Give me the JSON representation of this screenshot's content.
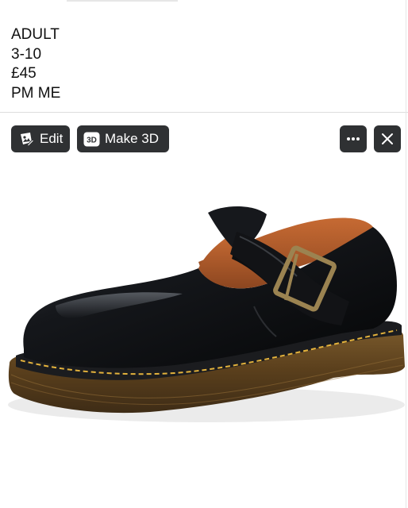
{
  "post": {
    "lines": [
      "ADULT",
      "3-10",
      "£45",
      "PM ME"
    ]
  },
  "toolbar": {
    "edit_label": "Edit",
    "make3d_label": "Make 3D",
    "make3d_icon_text": "3D"
  },
  "icons": {
    "edit": "photo-edit-icon",
    "make3d": "3d-icon",
    "more": "ellipsis-icon",
    "close": "close-icon"
  },
  "colors": {
    "button_bg": "#2f3133",
    "button_text": "#ffffff"
  }
}
